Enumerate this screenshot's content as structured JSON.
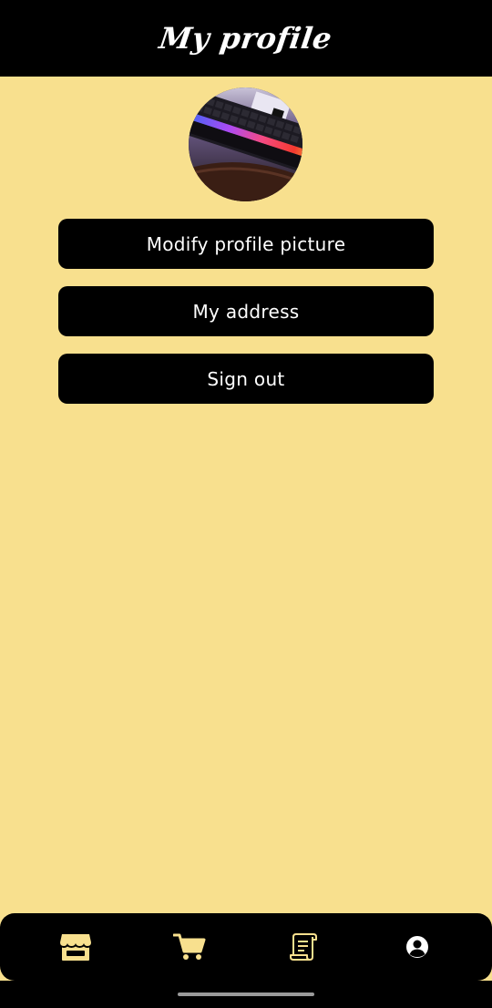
{
  "header": {
    "title": "My profile"
  },
  "profile": {
    "avatar_icon": "profile-photo-keyboard"
  },
  "actions": {
    "modify_picture_label": "Modify profile picture",
    "address_label": "My address",
    "sign_out_label": "Sign out"
  },
  "bottom_nav": {
    "items": [
      {
        "icon": "store-icon",
        "active": true
      },
      {
        "icon": "cart-icon",
        "active": false
      },
      {
        "icon": "receipt-icon",
        "active": false
      },
      {
        "icon": "account-circle-icon",
        "active": false
      }
    ]
  },
  "colors": {
    "background": "#f8e08e",
    "bars": "#000000",
    "accent": "#f8e08e",
    "button_text": "#ffffff"
  }
}
